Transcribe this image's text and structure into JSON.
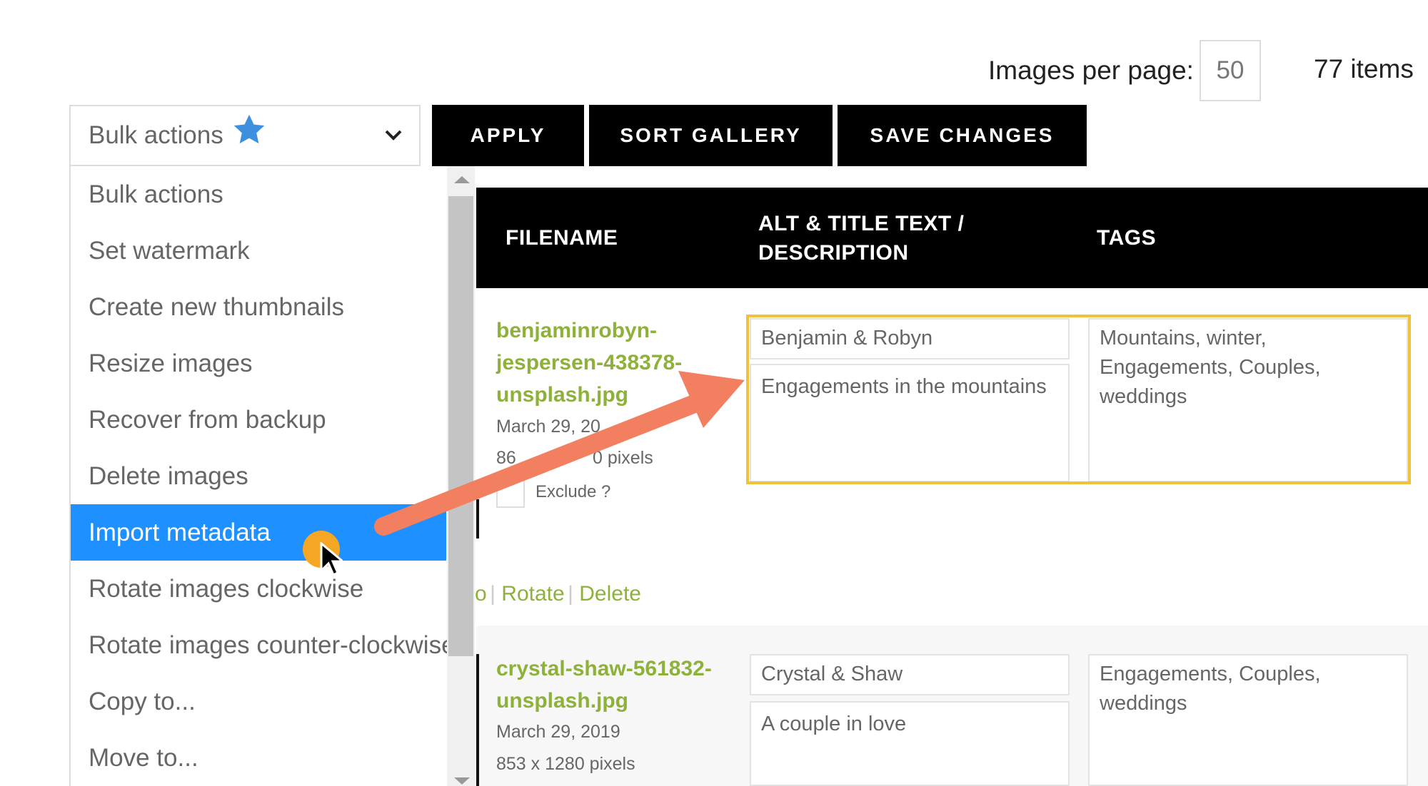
{
  "toolbar": {
    "images_per_page_label": "Images per page:",
    "images_per_page_value": "50",
    "items_count": "77 items",
    "bulk_select_label": "Bulk actions",
    "apply_label": "APPLY",
    "sort_label": "SORT GALLERY",
    "save_label": "SAVE CHANGES"
  },
  "dropdown": {
    "items": [
      {
        "label": "Bulk actions"
      },
      {
        "label": "Set watermark"
      },
      {
        "label": "Create new thumbnails"
      },
      {
        "label": "Resize images"
      },
      {
        "label": "Recover from backup"
      },
      {
        "label": "Delete images"
      },
      {
        "label": "Import metadata"
      },
      {
        "label": "Rotate images clockwise"
      },
      {
        "label": "Rotate images counter-clockwise"
      },
      {
        "label": "Copy to..."
      },
      {
        "label": "Move to..."
      }
    ],
    "active_index": 6
  },
  "table": {
    "headers": {
      "filename": "FILENAME",
      "alt_line1": "ALT & TITLE TEXT /",
      "alt_line2": "DESCRIPTION",
      "tags": "TAGS"
    },
    "rows": [
      {
        "filename_lines": [
          "benjaminrobyn-",
          "jespersen-438378-",
          "unsplash.jpg"
        ],
        "date": "March 29, 20",
        "dimensions_partial": "0 pixels",
        "dimensions_prefix": "86",
        "exclude_label": "Exclude ?",
        "alt_title": "Benjamin & Robyn",
        "description": "Engagements in the mountains",
        "tags": "Mountains, winter, Engagements, Couples, weddings",
        "actions": {
          "partial": "o",
          "rotate": "Rotate",
          "delete": "Delete"
        }
      },
      {
        "filename_lines": [
          "crystal-shaw-561832-",
          "unsplash.jpg"
        ],
        "date": "March 29, 2019",
        "dimensions": "853 x 1280 pixels",
        "alt_title": "Crystal & Shaw",
        "description": "A couple in love",
        "tags": "Engagements, Couples, weddings"
      }
    ]
  },
  "colors": {
    "accent_link": "#8db13a",
    "highlight_border": "#f0c23a",
    "active_item": "#1e90ff",
    "arrow": "#f28060",
    "cursor_dot": "#f5a623",
    "star": "#3d8fe0"
  },
  "icons": {
    "star": "star-icon",
    "chevron": "chevron-down-icon",
    "arrow": "annotation-arrow-icon",
    "cursor": "mouse-pointer-icon"
  }
}
